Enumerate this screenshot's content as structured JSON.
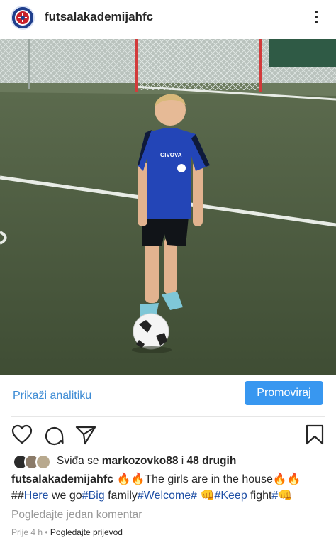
{
  "post": {
    "username": "futsalakademijahfc",
    "image_alt": "Girl in blue Givova kit standing on futsal turf with one foot on a ball in front of a goal",
    "kit_brand": "GIVOVA"
  },
  "analytics": {
    "insights_label": "Prikaži analitiku",
    "promote_label": "Promoviraj"
  },
  "actions": {
    "icons": [
      "heart-icon",
      "comment-icon",
      "share-icon",
      "bookmark-icon"
    ]
  },
  "likes": {
    "prefix": "Sviđa se",
    "user": "markozovko88",
    "joiner": "i",
    "others": "48 drugih"
  },
  "caption": {
    "username": "futsalakademijahfc",
    "fire1": "🔥🔥",
    "text1": "The girls are in the house",
    "fire2": "🔥🔥",
    "hash_prefix": "##",
    "tag1": "Here",
    "t1": " we go",
    "tag2": "#Big",
    "t2": " family",
    "tag3": "#Welcome#",
    "fist1": "👊",
    "tag4": "#Keep",
    "t3": " fight",
    "tag5": "#",
    "fist2": "👊"
  },
  "comments": {
    "view_label": "Pogledajte jedan komentar"
  },
  "meta": {
    "time": "Prije 4 h",
    "separator": " • ",
    "translate_label": "Pogledajte prijevod"
  },
  "colors": {
    "accent": "#3897f0",
    "link": "#3d8bd4",
    "hashtag": "#1e4fa5",
    "muted": "#999999"
  }
}
